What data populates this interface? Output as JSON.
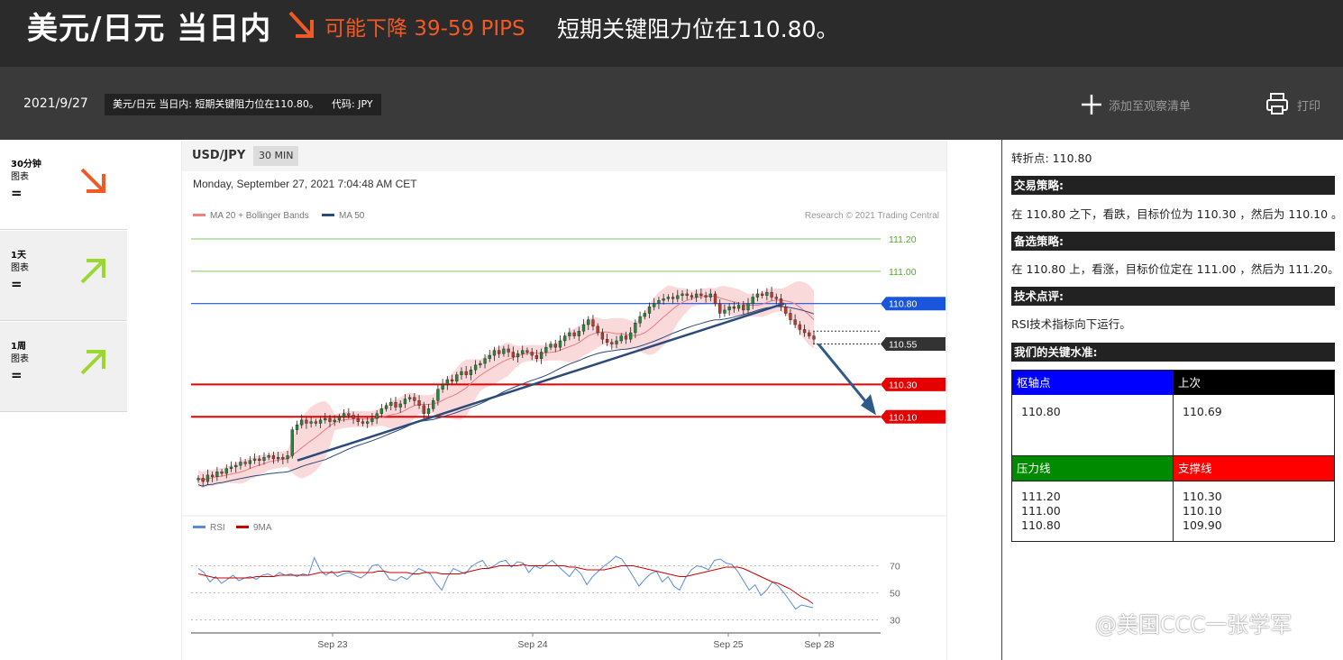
{
  "header": {
    "title": "美元/日元 当日内",
    "forecast": "可能下降 39-59 PIPS",
    "summary": "短期关键阻力位在110.80。",
    "arrow_icon": "down-right-arrow-icon",
    "accent_color": "#f15a24"
  },
  "subbar": {
    "date": "2021/9/27",
    "headline_chip": "美元/日元 当日内: 短期关键阻力位在110.80。",
    "code_chip": "代码: JPY",
    "add_watchlist": "添加至观察清单",
    "print": "打印"
  },
  "timeframes": [
    {
      "title": "30分钟",
      "sub": "图表",
      "eq": "=",
      "direction": "down",
      "color": "#f15a24"
    },
    {
      "title": "1天",
      "sub": "图表",
      "eq": "=",
      "direction": "up",
      "color": "#9bd82f"
    },
    {
      "title": "1周",
      "sub": "图表",
      "eq": "=",
      "direction": "up",
      "color": "#9bd82f"
    }
  ],
  "chart": {
    "symbol": "USD/JPY",
    "timeframe": "30 MIN",
    "timestamp": "Monday, September 27, 2021 7:04:48 AM CET",
    "legend_ma20": "MA 20 + Bollinger Bands",
    "legend_ma50": "MA 50",
    "copyright": "Research © 2021 Trading Central",
    "rsi_legend": "RSI",
    "rsi_ma_legend": "9MA"
  },
  "chart_data": {
    "type": "candlestick",
    "price_levels": [
      {
        "value": 111.2,
        "label": "111.20",
        "kind": "target",
        "color": "#4caf1e"
      },
      {
        "value": 111.0,
        "label": "111.00",
        "kind": "target",
        "color": "#4caf1e"
      },
      {
        "value": 110.8,
        "label": "110.80",
        "kind": "pivot",
        "color": "#1a56db"
      },
      {
        "value": 110.55,
        "label": "110.55",
        "kind": "last",
        "color": "#333333"
      },
      {
        "value": 110.3,
        "label": "110.30",
        "kind": "support",
        "color": "#e60000"
      },
      {
        "value": 110.1,
        "label": "110.10",
        "kind": "support",
        "color": "#e60000"
      }
    ],
    "x_ticks": [
      "Sep 23",
      "Sep 24",
      "Sep 25",
      "Sep 28"
    ],
    "price_range": [
      109.6,
      111.3
    ],
    "close": [
      109.72,
      109.7,
      109.74,
      109.73,
      109.76,
      109.75,
      109.78,
      109.79,
      109.8,
      109.82,
      109.81,
      109.83,
      109.84,
      109.83,
      109.85,
      109.86,
      109.84,
      109.85,
      109.84,
      109.86,
      110.02,
      110.05,
      110.08,
      110.06,
      110.07,
      110.06,
      110.08,
      110.09,
      110.07,
      110.08,
      110.1,
      110.12,
      110.11,
      110.09,
      110.07,
      110.06,
      110.07,
      110.09,
      110.12,
      110.15,
      110.17,
      110.19,
      110.16,
      110.18,
      110.21,
      110.22,
      110.2,
      110.17,
      110.12,
      110.15,
      110.2,
      110.27,
      110.3,
      110.33,
      110.32,
      110.36,
      110.38,
      110.36,
      110.39,
      110.42,
      110.43,
      110.46,
      110.48,
      110.51,
      110.49,
      110.52,
      110.5,
      110.47,
      110.49,
      110.51,
      110.5,
      110.48,
      110.46,
      110.5,
      110.53,
      110.55,
      110.53,
      110.57,
      110.6,
      110.62,
      110.6,
      110.63,
      110.67,
      110.7,
      110.66,
      110.62,
      110.58,
      110.56,
      110.55,
      110.57,
      110.6,
      110.58,
      110.62,
      110.68,
      110.72,
      110.74,
      110.78,
      110.8,
      110.82,
      110.83,
      110.84,
      110.83,
      110.85,
      110.86,
      110.85,
      110.84,
      110.86,
      110.85,
      110.84,
      110.86,
      110.8,
      110.74,
      110.76,
      110.78,
      110.77,
      110.79,
      110.76,
      110.8,
      110.84,
      110.86,
      110.85,
      110.87,
      110.84,
      110.83,
      110.78,
      110.74,
      110.7,
      110.67,
      110.64,
      110.62,
      110.6,
      110.58
    ],
    "rsi": {
      "levels": [
        70,
        50,
        30
      ],
      "range": [
        25,
        85
      ],
      "rsi_values": [
        68,
        65,
        58,
        62,
        57,
        60,
        63,
        59,
        61,
        62,
        60,
        63,
        64,
        62,
        65,
        63,
        64,
        62,
        64,
        63,
        76,
        67,
        63,
        66,
        62,
        64,
        65,
        63,
        61,
        64,
        70,
        71,
        66,
        60,
        59,
        62,
        60,
        64,
        68,
        66,
        64,
        57,
        52,
        62,
        68,
        66,
        64,
        69,
        72,
        74,
        68,
        70,
        73,
        74,
        69,
        73,
        72,
        65,
        70,
        68,
        71,
        74,
        70,
        66,
        62,
        68,
        64,
        56,
        62,
        66,
        70,
        73,
        77,
        75,
        69,
        62,
        55,
        60,
        64,
        66,
        58,
        62,
        55,
        52,
        61,
        67,
        70,
        69,
        67,
        74,
        75,
        72,
        71,
        66,
        59,
        52,
        56,
        48,
        52,
        58,
        55,
        50,
        44,
        38,
        41,
        40,
        39
      ],
      "ma_values": [
        64,
        63,
        62,
        61,
        61,
        61,
        61,
        61,
        61,
        61,
        62,
        62,
        62,
        62,
        63,
        63,
        63,
        63,
        63,
        63,
        64,
        65,
        65,
        65,
        65,
        66,
        66,
        65,
        65,
        65,
        65,
        66,
        66,
        65,
        65,
        65,
        65,
        64,
        64,
        65,
        65,
        65,
        64,
        64,
        64,
        64,
        65,
        66,
        67,
        68,
        68,
        69,
        70,
        70,
        70,
        70,
        71,
        70,
        70,
        70,
        70,
        70,
        70,
        70,
        69,
        69,
        68,
        67,
        67,
        67,
        67,
        68,
        69,
        70,
        70,
        70,
        69,
        68,
        67,
        66,
        65,
        64,
        63,
        62,
        62,
        63,
        64,
        65,
        66,
        67,
        68,
        69,
        69,
        69,
        68,
        66,
        64,
        62,
        60,
        58,
        57,
        55,
        53,
        50,
        47,
        45,
        42
      ]
    }
  },
  "info": {
    "pivot_line": "转折点: 110.80",
    "strategy_head": "交易策略:",
    "strategy_text": "在 110.80 之下，看跌，目标价位为 110.30 ，然后为 110.10 。",
    "alt_head": "备选策略:",
    "alt_text": "在 110.80 上，看涨，目标价位定在 111.00 ，然后为 111.20。",
    "comment_head": "技术点评:",
    "comment_text": "RSI技术指标向下运行。",
    "levels_head": "我们的关键水准:",
    "table": {
      "pivot_head": "枢轴点",
      "last_head": "上次",
      "pivot_value": "110.80",
      "last_value": "110.69",
      "resistance_head": "压力线",
      "support_head": "支撑线",
      "resistance_values": [
        "111.20",
        "111.00",
        "110.80"
      ],
      "support_values": [
        "110.30",
        "110.10",
        "109.90"
      ],
      "colors": {
        "pivot": "#0000ff",
        "last": "#000000",
        "resistance": "#008a00",
        "support": "#ff0000"
      }
    }
  },
  "watermark": "@美国CCC一张学军"
}
